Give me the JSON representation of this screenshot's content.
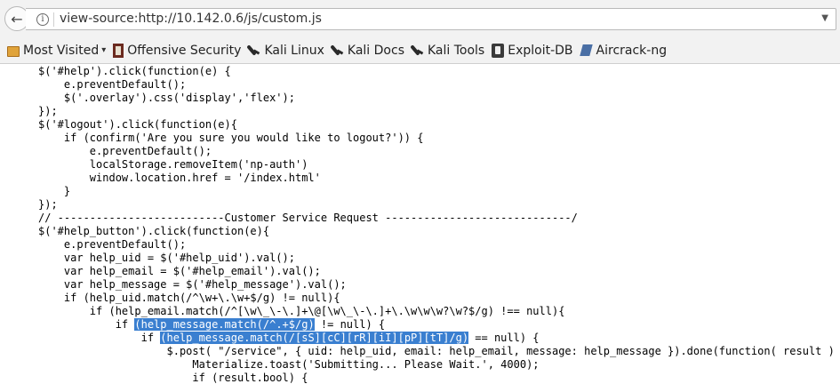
{
  "navbar": {
    "url": "view-source:http://10.142.0.6/js/custom.js"
  },
  "bookmarks": [
    {
      "label": "Most Visited",
      "icon": "folder-icon"
    },
    {
      "label": "Offensive Security",
      "icon": "offsec-icon"
    },
    {
      "label": "Kali Linux",
      "icon": "kali-dragon-icon"
    },
    {
      "label": "Kali Docs",
      "icon": "kali-dragon-icon"
    },
    {
      "label": "Kali Tools",
      "icon": "kali-dragon-icon"
    },
    {
      "label": "Exploit-DB",
      "icon": "exploit-db-icon"
    },
    {
      "label": "Aircrack-ng",
      "icon": "aircrack-icon"
    }
  ],
  "code": {
    "lines": [
      {
        "pre": "$('#help').click(function(e) {"
      },
      {
        "pre": "    e.preventDefault();"
      },
      {
        "pre": "    $('.overlay').css('display','flex');"
      },
      {
        "pre": "});"
      },
      {
        "pre": "$('#logout').click(function(e){"
      },
      {
        "pre": "    if (confirm('Are you sure you would like to logout?')) {"
      },
      {
        "pre": "        e.preventDefault();"
      },
      {
        "pre": "        localStorage.removeItem('np-auth')"
      },
      {
        "pre": "        window.location.href = '/index.html'"
      },
      {
        "pre": "    }"
      },
      {
        "pre": "});"
      },
      {
        "pre": "// --------------------------Customer Service Request -----------------------------/"
      },
      {
        "pre": "$('#help_button').click(function(e){"
      },
      {
        "pre": "    e.preventDefault();"
      },
      {
        "pre": "    var help_uid = $('#help_uid').val();"
      },
      {
        "pre": "    var help_email = $('#help_email').val();"
      },
      {
        "pre": "    var help_message = $('#help_message').val();"
      },
      {
        "pre": "    if (help_uid.match(/^\\w+\\.\\w+$/g) != null){"
      },
      {
        "pre": "        if (help_email.match(/^[\\w\\_\\-\\.]+\\@[\\w\\_\\-\\.]+\\.\\w\\w\\w?\\w?$/g) !== null){"
      },
      {
        "pre": "            if ",
        "hl": "(help_message.match(/^.+$/g)",
        "post": " != null) {"
      },
      {
        "pre": "                if ",
        "hl": "(help_message.match(/[sS][cC][rR][iI][pP][tT]/g)",
        "post": " == null) {"
      },
      {
        "pre": "                    $.post( \"/service\", { uid: help_uid, email: help_email, message: help_message }).done(function( result ) {"
      },
      {
        "pre": "                        Materialize.toast('Submitting... Please Wait.', 4000);"
      },
      {
        "pre": "                        if (result.bool) {"
      }
    ]
  }
}
